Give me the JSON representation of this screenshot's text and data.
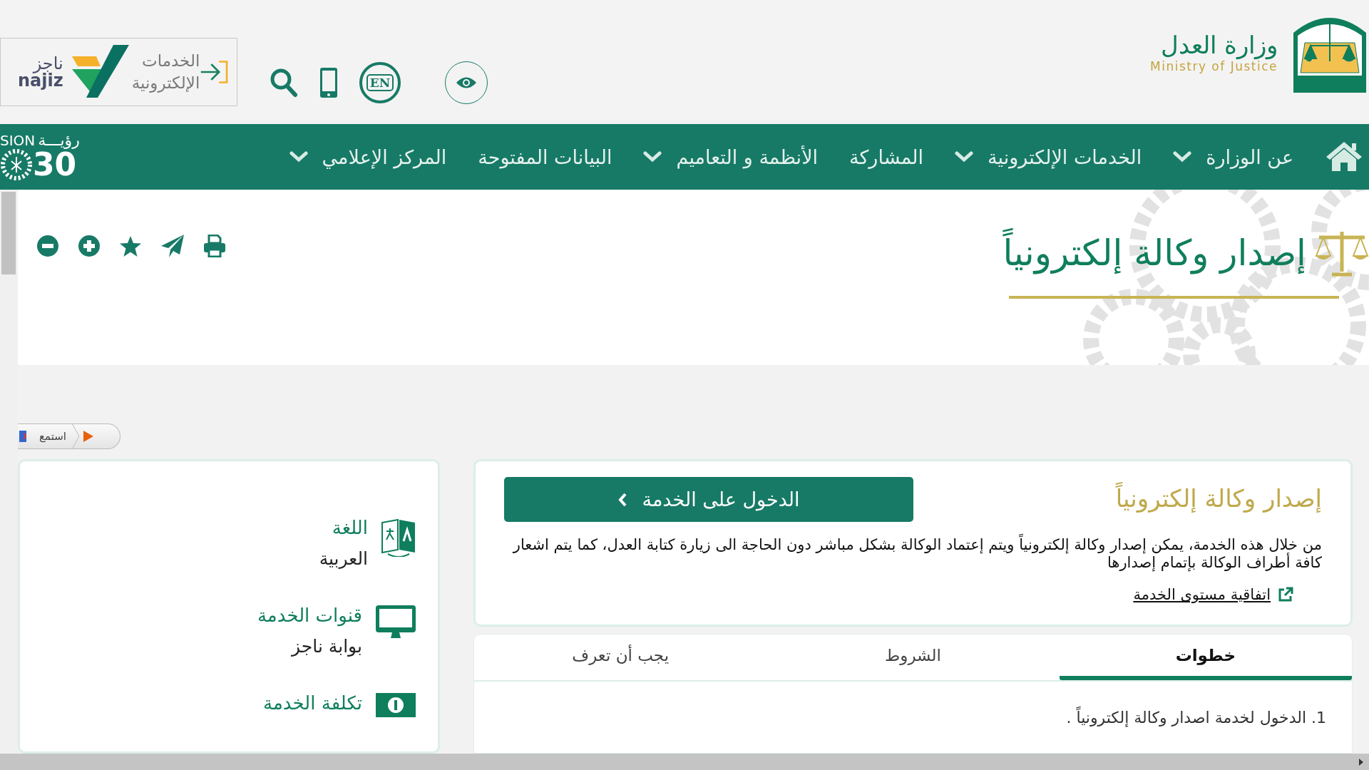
{
  "header": {
    "logo": {
      "arabic": "وزارة العدل",
      "english": "Ministry of Justice"
    },
    "najiz": {
      "label": "الخدمات الإلكترونية",
      "brand_arabic": "ناجز",
      "brand_latin": "najiz"
    },
    "language_button": "EN"
  },
  "nav": {
    "items": [
      {
        "label": "عن الوزارة",
        "has_menu": true
      },
      {
        "label": "الخدمات الإلكترونية",
        "has_menu": true
      },
      {
        "label": "المشاركة",
        "has_menu": false
      },
      {
        "label": "الأنظمة و التعاميم",
        "has_menu": true
      },
      {
        "label": "البيانات المفتوحة",
        "has_menu": false
      },
      {
        "label": "المركز الإعلامي",
        "has_menu": true
      }
    ],
    "vision": {
      "arabic": "رؤيـــة",
      "latin": "SION",
      "year": "30"
    }
  },
  "page_title": "إصدار وكالة إلكترونياً",
  "listen_button": "استمع",
  "service": {
    "title": "إصدار وكالة إلكترونياً",
    "button": "الدخول على الخدمة",
    "description": "من خلال هذه الخدمة، يمكن إصدار وكالة إلكترونياً ويتم إعتماد الوكالة بشكل مباشر دون الحاجة الى زيارة كتابة العدل، كما يتم اشعار كافة أطراف الوكالة بإتمام إصدارها",
    "link": "اتفاقية مستوى الخدمة"
  },
  "tabs": [
    {
      "label": "خطوات",
      "selected": true
    },
    {
      "label": "الشروط",
      "selected": false
    },
    {
      "label": "يجب أن تعرف",
      "selected": false
    }
  ],
  "steps": [
    "1. الدخول لخدمة اصدار وكالة إلكترونياً ."
  ],
  "info": [
    {
      "kind": "language",
      "label": "اللغة",
      "value": "العربية"
    },
    {
      "kind": "channels",
      "label": "قنوات الخدمة",
      "value": "بوابة ناجز"
    },
    {
      "kind": "cost",
      "label": "تكلفة الخدمة"
    }
  ]
}
